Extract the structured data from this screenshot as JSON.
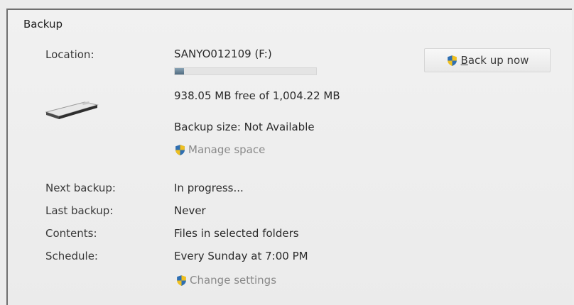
{
  "section": {
    "title": "Backup"
  },
  "location": {
    "label": "Location:",
    "drive_name": "SANYO012109 (F:)",
    "usage_fraction": 0.066,
    "free_space_text": "938.05 MB free of 1,004.22 MB"
  },
  "backup_size": {
    "text": "Backup size: Not Available"
  },
  "manage_space": {
    "label": "Manage space",
    "icon": "uac-shield-icon"
  },
  "back_up_now": {
    "label_first": "B",
    "label_rest": "ack up now",
    "icon": "uac-shield-icon"
  },
  "details": [
    {
      "label": "Next backup:",
      "value": "In progress..."
    },
    {
      "label": "Last backup:",
      "value": "Never"
    },
    {
      "label": "Contents:",
      "value": "Files in selected folders"
    },
    {
      "label": "Schedule:",
      "value": "Every Sunday at 7:00 PM"
    }
  ],
  "change_settings": {
    "label": "Change settings",
    "icon": "uac-shield-icon"
  },
  "colors": {
    "link": "#8a8a8a",
    "progress_fill": "#4f6b80",
    "border": "#707070"
  }
}
